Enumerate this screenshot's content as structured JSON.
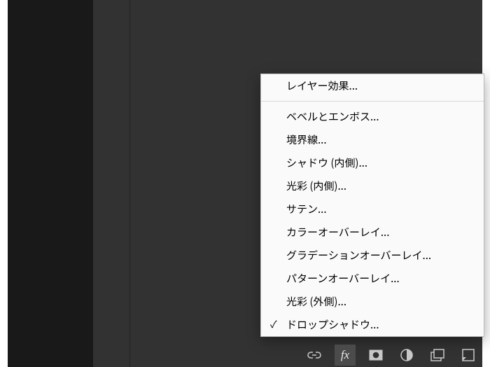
{
  "menu": {
    "top": "レイヤー効果...",
    "items": [
      {
        "label": "ベベルとエンボス...",
        "checked": false
      },
      {
        "label": "境界線...",
        "checked": false
      },
      {
        "label": "シャドウ (内側)...",
        "checked": false
      },
      {
        "label": "光彩 (内側)...",
        "checked": false
      },
      {
        "label": "サテン...",
        "checked": false
      },
      {
        "label": "カラーオーバーレイ...",
        "checked": false
      },
      {
        "label": "グラデーションオーバーレイ...",
        "checked": false
      },
      {
        "label": "パターンオーバーレイ...",
        "checked": false
      },
      {
        "label": "光彩 (外側)...",
        "checked": false
      },
      {
        "label": "ドロップシャドウ...",
        "checked": true
      }
    ]
  },
  "toolbar": {
    "icons": [
      {
        "name": "link-icon"
      },
      {
        "name": "fx-icon"
      },
      {
        "name": "mask-icon"
      },
      {
        "name": "adjustment-icon"
      },
      {
        "name": "group-icon"
      },
      {
        "name": "new-layer-icon"
      },
      {
        "name": "trash-icon"
      }
    ],
    "active": "fx-icon"
  }
}
